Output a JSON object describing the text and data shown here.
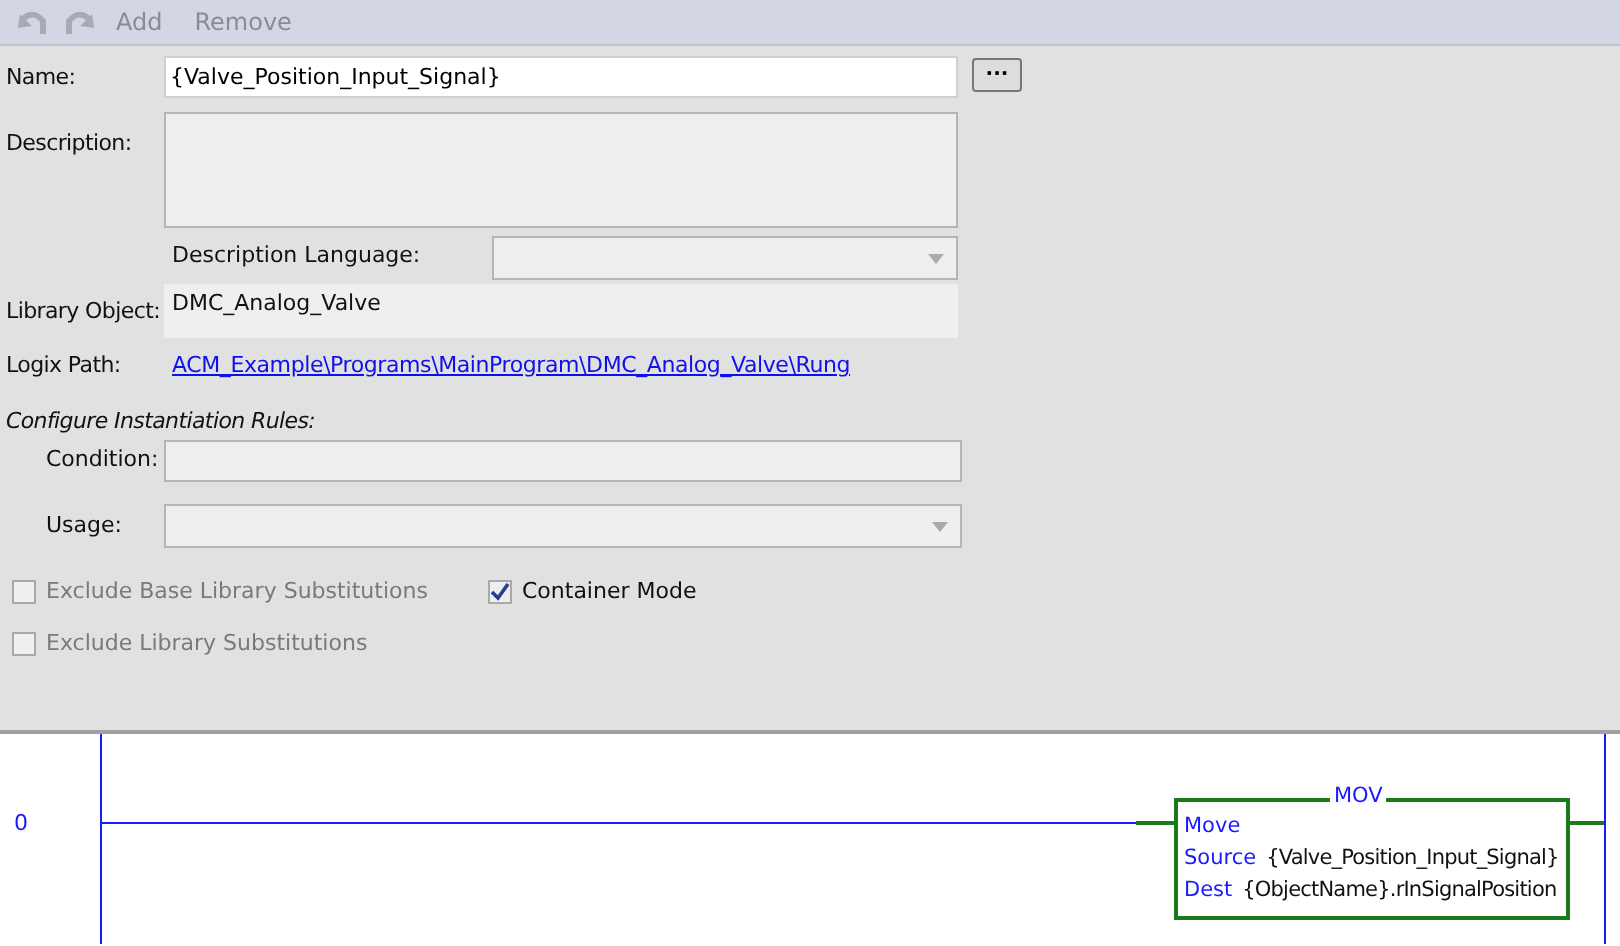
{
  "toolbar": {
    "undo_disabled": true,
    "redo_disabled": true,
    "buttons": [
      {
        "label": "Add",
        "disabled": true
      },
      {
        "label": "Remove",
        "disabled": true
      }
    ]
  },
  "form": {
    "name": {
      "label": "Name:",
      "value": "{Valve_Position_Input_Signal}",
      "browse": "···"
    },
    "description": {
      "label": "Description:"
    },
    "description_language": {
      "label": "Description Language:"
    },
    "library_object": {
      "label": "Library Object:",
      "value": "DMC_Analog_Valve"
    },
    "logix_path": {
      "label": "Logix Path:",
      "link": "ACM_Example\\Programs\\MainProgram\\DMC_Analog_Valve\\Rung"
    },
    "section_title": "Configure Instantiation Rules:",
    "condition": {
      "label": "Condition:"
    },
    "usage": {
      "label": "Usage:"
    },
    "checkboxes": [
      {
        "label": "Exclude Base Library Substitutions",
        "checked": false,
        "disabled": true
      },
      {
        "label": "Container Mode",
        "checked": true,
        "disabled": false
      },
      {
        "label": "Exclude Library Substitutions",
        "checked": false,
        "disabled": true
      }
    ]
  },
  "ladder": {
    "rung_number": "0",
    "instruction": {
      "name": "MOV",
      "title": "Move",
      "operands": [
        {
          "label": "Source",
          "value": "{Valve_Position_Input_Signal}"
        },
        {
          "label": "Dest",
          "value": "{ObjectName}.rInSignalPosition"
        }
      ]
    }
  }
}
